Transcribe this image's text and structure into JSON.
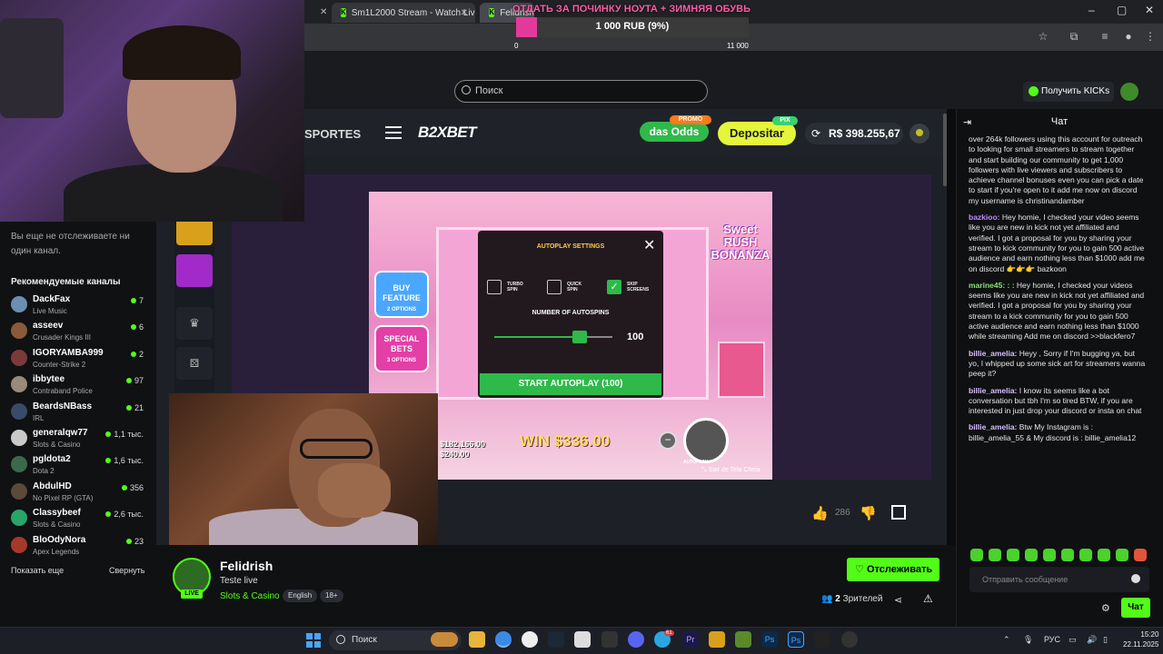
{
  "browser": {
    "tabs": [
      {
        "label": "Sm1L2000 Stream - Watch Live"
      },
      {
        "label": "Felidrish"
      }
    ],
    "window_controls": [
      "–",
      "▢",
      "✕"
    ]
  },
  "donation": {
    "title": "ОТДАТЬ ЗА ПОЧИНКУ НОУТА + ЗИМНЯЯ ОБУВЬ",
    "amount": "1 000 RUB (9%)",
    "progress": 0.09,
    "min": "0",
    "max": "11 000"
  },
  "kick": {
    "search_placeholder": "Поиск",
    "get_kicks": "Получить KICKs"
  },
  "sidebar": {
    "note": "Вы еще не отслеживаете ни один канал.",
    "heading": "Рекомендуемые каналы",
    "channels": [
      {
        "name": "DackFax",
        "category": "Live Music",
        "viewers": "7",
        "color": "#6b8fb3"
      },
      {
        "name": "asseev",
        "category": "Crusader Kings III",
        "viewers": "6",
        "color": "#8a5a3a"
      },
      {
        "name": "IGORYAMBA999",
        "category": "Counter-Strike 2",
        "viewers": "2",
        "color": "#7a3a3a"
      },
      {
        "name": "ibbytee",
        "category": "Contraband Police",
        "viewers": "97",
        "color": "#9a8a7a"
      },
      {
        "name": "BeardsNBass",
        "category": "IRL",
        "viewers": "21",
        "color": "#3a4a6a"
      },
      {
        "name": "generalqw77",
        "category": "Slots & Casino",
        "viewers": "1,1 тыс.",
        "color": "#c9c9c9"
      },
      {
        "name": "pgldota2",
        "category": "Dota 2",
        "viewers": "1,6 тыс.",
        "color": "#3a6a4a"
      },
      {
        "name": "AbdulHD",
        "category": "No Pixel RP (GTA)",
        "viewers": "356",
        "color": "#5a4a3a"
      },
      {
        "name": "Classybeef",
        "category": "Slots & Casino",
        "viewers": "2,6 тыс.",
        "color": "#2aa56a"
      },
      {
        "name": "BloOdyNora",
        "category": "Apex Legends",
        "viewers": "23",
        "color": "#a53a2a"
      }
    ],
    "show_more": "Показать еще",
    "collapse": "Свернуть"
  },
  "casino": {
    "sportes": "SPORTES",
    "logo": "B2XBET",
    "odds_label": "das Odds",
    "promo_badge": "PROMO",
    "deposit_label": "Depositar",
    "pix_badge": "PIX",
    "balance": "R$ 398.255,67"
  },
  "game": {
    "autoplay_title": "AUTOPLAY SETTINGS",
    "options": [
      {
        "label": "TURBO SPIN",
        "checked": false
      },
      {
        "label": "QUICK SPIN",
        "checked": false
      },
      {
        "label": "SKIP SCREENS",
        "checked": true
      }
    ],
    "autospins_label": "NUMBER OF AUTOSPINS",
    "autospins_value": "100",
    "start_label": "START AUTOPLAY (100)",
    "buy_feature": "BUY FEATURE",
    "buy_feature_sub": "2 OPTIONS",
    "special_bets": "SPECIAL BETS",
    "special_bets_sub": "3 OPTIONS",
    "game_logo": "Sweet RUSH BONANZA",
    "win_label": "WIN",
    "win_amount": "$336.00",
    "credit": "$182,166.00",
    "bet": "$240.00",
    "autoplay_btn": "AUTOPLAY",
    "exit_fullscreen": "Sair de Tela Cheia",
    "likes": "286"
  },
  "stream": {
    "name": "Felidrish",
    "live": "LIVE",
    "title": "Teste live",
    "category": "Slots & Casino",
    "tags": [
      "English",
      "18+"
    ],
    "follow_label": "Отслеживать",
    "viewers_count": "2",
    "viewers_label": "Зрителей"
  },
  "chat": {
    "title": "Чат",
    "messages": [
      {
        "user": "",
        "color": "#e6e6e6",
        "text": "over 264k followers using this account for outreach to looking for small streamers to stream together and start building our community to get 1,000 followers with live viewers and subscribers to achieve channel bonuses even you can pick a date to start if you're open to it add me now on discord my username is christinandamber"
      },
      {
        "user": "bazkioo:",
        "color": "#c08cff",
        "text": " Hey homie, I checked your video seems like you are new in kick not yet affiliated and verified. I got a proposal for you by sharing your stream to kick community for you to gain 500 active audience and earn nothing less than $1000 add me on discord 👉👉👉 bazkoon"
      },
      {
        "user": "marine45: : :",
        "color": "#8fe07a",
        "text": " Hey homie, I checked your videos seems like you are new in kick not yet affiliated and verified. I got a proposal for you by sharing your stream to a kick community for you to gain 500 active audience and earn nothing less than $1000 while streaming Add me on discord >>blackfero7"
      },
      {
        "user": "billie_amelia:",
        "color": "#d8c0ff",
        "text": " Heyy , Sorry if I'm bugging ya, but yo, I whipped up some sick art for streamers wanna peep it?"
      },
      {
        "user": "billie_amelia:",
        "color": "#d8c0ff",
        "text": " I know its seems like a bot conversation but tbh I'm so tired BTW, if you are interested in just drop your discord or insta on chat"
      },
      {
        "user": "billie_amelia:",
        "color": "#d8c0ff",
        "text": " Btw My Instagram is : billie_amelia_55 & My discord is : billie_amelia12"
      }
    ],
    "input_placeholder": "Отправить сообщение",
    "send_label": "Чат"
  },
  "taskbar": {
    "search": "Поиск",
    "lang": "РУС",
    "time": "15:20",
    "date": "22.11.2025",
    "badge": "61"
  }
}
